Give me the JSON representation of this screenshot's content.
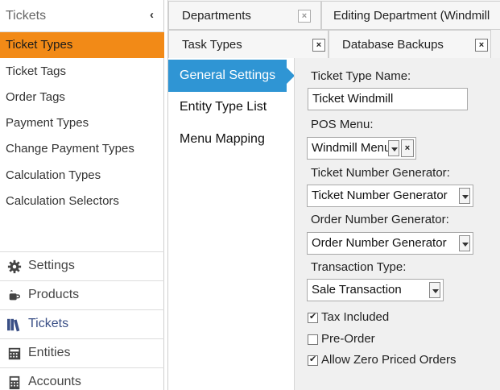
{
  "sidebar": {
    "header": "Tickets",
    "collapse_glyph": "‹",
    "items": [
      {
        "label": "Ticket Types",
        "selected": true
      },
      {
        "label": "Ticket Tags"
      },
      {
        "label": "Order Tags"
      },
      {
        "label": "Payment Types"
      },
      {
        "label": "Change Payment Types"
      },
      {
        "label": "Calculation Types"
      },
      {
        "label": "Calculation Selectors"
      }
    ],
    "sections": [
      {
        "label": "Settings",
        "icon": "gear-icon"
      },
      {
        "label": "Products",
        "icon": "coffee-cup-icon"
      },
      {
        "label": "Tickets",
        "icon": "books-icon",
        "active": true
      },
      {
        "label": "Entities",
        "icon": "entities-icon"
      },
      {
        "label": "Accounts",
        "icon": "calculator-icon"
      }
    ]
  },
  "tabs": {
    "row1": [
      {
        "label": "Departments",
        "close": "×"
      },
      {
        "label": "Editing Department (Windmill"
      }
    ],
    "row2": [
      {
        "label": "Task Types",
        "close": "×"
      },
      {
        "label": "Database Backups",
        "close": "×"
      }
    ]
  },
  "subnav": {
    "items": [
      {
        "label": "General Settings",
        "active": true
      },
      {
        "label": "Entity Type List"
      },
      {
        "label": "Menu Mapping"
      }
    ]
  },
  "form": {
    "ticket_type_name_label": "Ticket Type Name:",
    "ticket_type_name_value": "Ticket Windmill",
    "pos_menu_label": "POS Menu:",
    "pos_menu_value": "Windmill Menu",
    "pos_menu_clear": "×",
    "ticket_number_generator_label": "Ticket Number Generator:",
    "ticket_number_generator_value": "Ticket Number Generator",
    "order_number_generator_label": "Order Number Generator:",
    "order_number_generator_value": "Order Number Generator",
    "transaction_type_label": "Transaction Type:",
    "transaction_type_value": "Sale Transaction",
    "checks": [
      {
        "label": "Tax Included",
        "checked": true
      },
      {
        "label": "Pre-Order",
        "checked": false
      },
      {
        "label": "Allow Zero Priced Orders",
        "checked": true
      }
    ]
  },
  "colors": {
    "selected_item": "#f28a17",
    "active_nav": "#2f95d4",
    "active_section": "#3a4f86"
  }
}
